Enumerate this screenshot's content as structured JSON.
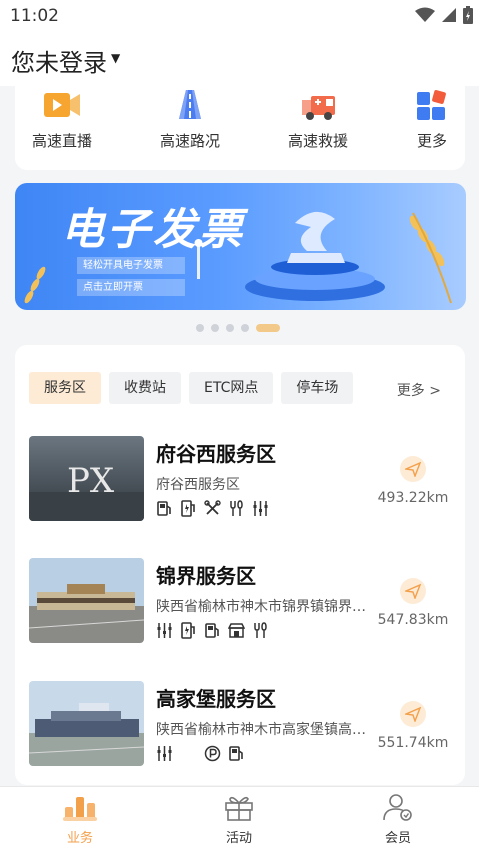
{
  "status_bar": {
    "time": "11:02"
  },
  "header": {
    "login_label": "您未登录"
  },
  "quick_actions": [
    {
      "label": "高速直播",
      "icon": "video-play-icon"
    },
    {
      "label": "高速路况",
      "icon": "road-icon"
    },
    {
      "label": "高速救援",
      "icon": "tow-truck-icon"
    },
    {
      "label": "更多",
      "icon": "grid-more-icon"
    }
  ],
  "banner": {
    "title": "电子发票",
    "subtitle": "轻松开具电子发票",
    "cta": "点击立即开票"
  },
  "carousel": {
    "total": 5,
    "active": 4
  },
  "categories": {
    "tabs": [
      "服务区",
      "收费站",
      "ETC网点",
      "停车场"
    ],
    "active": "服务区",
    "more": "更多 >"
  },
  "service_areas": [
    {
      "name": "府谷西服务区",
      "address": "府谷西服务区",
      "distance": "493.22km",
      "facilities": [
        "fuel-icon",
        "charging-icon",
        "repair-icon",
        "restaurant-icon",
        "gas-icon"
      ]
    },
    {
      "name": "锦界服务区",
      "address": "陕西省榆林市神木市锦界镇锦界服务区",
      "distance": "547.83km",
      "facilities": [
        "gas-icon",
        "charging-icon",
        "fuel-icon",
        "shop-icon",
        "restaurant-icon"
      ]
    },
    {
      "name": "高家堡服务区",
      "address": "陕西省榆林市神木市高家堡镇高家堡服务区",
      "distance": "551.74km",
      "facilities": [
        "gas-icon",
        "parking-icon",
        "fuel-icon"
      ]
    }
  ],
  "bottom_nav": [
    {
      "label": "业务",
      "active": true
    },
    {
      "label": "活动",
      "active": false
    },
    {
      "label": "会员",
      "active": false
    }
  ],
  "colors": {
    "accent": "#f3a04b",
    "banner_blue": "#4a8ef7",
    "tab_active_bg": "#fdebd6"
  }
}
